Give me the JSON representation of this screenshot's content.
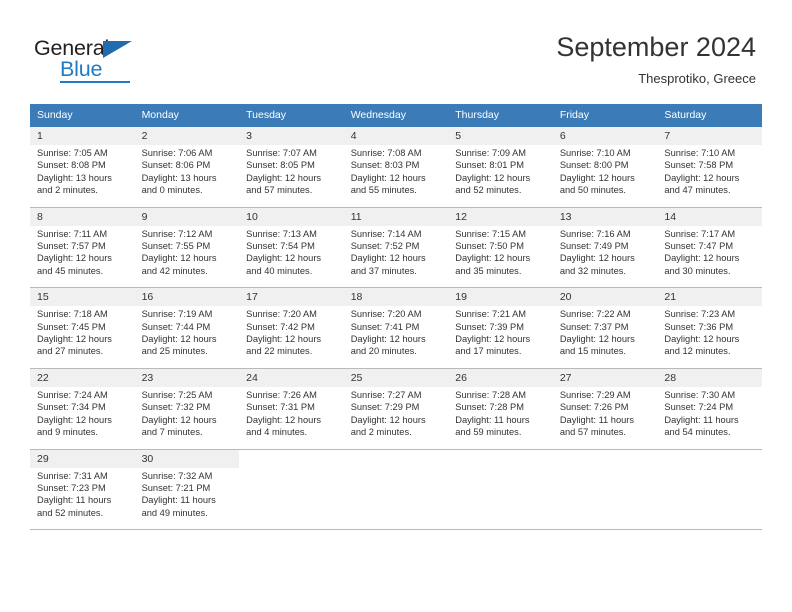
{
  "brand": {
    "name_top": "General",
    "name_bottom": "Blue",
    "accent_color": "#1f7bc4",
    "triangle_color": "#1f6cb0"
  },
  "header": {
    "title": "September 2024",
    "subtitle": "Thesprotiko, Greece"
  },
  "calendar": {
    "header_bg": "#3b7cb8",
    "daynum_bg": "#f0f0f0",
    "weekdays": [
      "Sunday",
      "Monday",
      "Tuesday",
      "Wednesday",
      "Thursday",
      "Friday",
      "Saturday"
    ],
    "weeks": [
      {
        "days": [
          {
            "num": "1",
            "sunrise": "Sunrise: 7:05 AM",
            "sunset": "Sunset: 8:08 PM",
            "daylight1": "Daylight: 13 hours",
            "daylight2": "and 2 minutes."
          },
          {
            "num": "2",
            "sunrise": "Sunrise: 7:06 AM",
            "sunset": "Sunset: 8:06 PM",
            "daylight1": "Daylight: 13 hours",
            "daylight2": "and 0 minutes."
          },
          {
            "num": "3",
            "sunrise": "Sunrise: 7:07 AM",
            "sunset": "Sunset: 8:05 PM",
            "daylight1": "Daylight: 12 hours",
            "daylight2": "and 57 minutes."
          },
          {
            "num": "4",
            "sunrise": "Sunrise: 7:08 AM",
            "sunset": "Sunset: 8:03 PM",
            "daylight1": "Daylight: 12 hours",
            "daylight2": "and 55 minutes."
          },
          {
            "num": "5",
            "sunrise": "Sunrise: 7:09 AM",
            "sunset": "Sunset: 8:01 PM",
            "daylight1": "Daylight: 12 hours",
            "daylight2": "and 52 minutes."
          },
          {
            "num": "6",
            "sunrise": "Sunrise: 7:10 AM",
            "sunset": "Sunset: 8:00 PM",
            "daylight1": "Daylight: 12 hours",
            "daylight2": "and 50 minutes."
          },
          {
            "num": "7",
            "sunrise": "Sunrise: 7:10 AM",
            "sunset": "Sunset: 7:58 PM",
            "daylight1": "Daylight: 12 hours",
            "daylight2": "and 47 minutes."
          }
        ]
      },
      {
        "days": [
          {
            "num": "8",
            "sunrise": "Sunrise: 7:11 AM",
            "sunset": "Sunset: 7:57 PM",
            "daylight1": "Daylight: 12 hours",
            "daylight2": "and 45 minutes."
          },
          {
            "num": "9",
            "sunrise": "Sunrise: 7:12 AM",
            "sunset": "Sunset: 7:55 PM",
            "daylight1": "Daylight: 12 hours",
            "daylight2": "and 42 minutes."
          },
          {
            "num": "10",
            "sunrise": "Sunrise: 7:13 AM",
            "sunset": "Sunset: 7:54 PM",
            "daylight1": "Daylight: 12 hours",
            "daylight2": "and 40 minutes."
          },
          {
            "num": "11",
            "sunrise": "Sunrise: 7:14 AM",
            "sunset": "Sunset: 7:52 PM",
            "daylight1": "Daylight: 12 hours",
            "daylight2": "and 37 minutes."
          },
          {
            "num": "12",
            "sunrise": "Sunrise: 7:15 AM",
            "sunset": "Sunset: 7:50 PM",
            "daylight1": "Daylight: 12 hours",
            "daylight2": "and 35 minutes."
          },
          {
            "num": "13",
            "sunrise": "Sunrise: 7:16 AM",
            "sunset": "Sunset: 7:49 PM",
            "daylight1": "Daylight: 12 hours",
            "daylight2": "and 32 minutes."
          },
          {
            "num": "14",
            "sunrise": "Sunrise: 7:17 AM",
            "sunset": "Sunset: 7:47 PM",
            "daylight1": "Daylight: 12 hours",
            "daylight2": "and 30 minutes."
          }
        ]
      },
      {
        "days": [
          {
            "num": "15",
            "sunrise": "Sunrise: 7:18 AM",
            "sunset": "Sunset: 7:45 PM",
            "daylight1": "Daylight: 12 hours",
            "daylight2": "and 27 minutes."
          },
          {
            "num": "16",
            "sunrise": "Sunrise: 7:19 AM",
            "sunset": "Sunset: 7:44 PM",
            "daylight1": "Daylight: 12 hours",
            "daylight2": "and 25 minutes."
          },
          {
            "num": "17",
            "sunrise": "Sunrise: 7:20 AM",
            "sunset": "Sunset: 7:42 PM",
            "daylight1": "Daylight: 12 hours",
            "daylight2": "and 22 minutes."
          },
          {
            "num": "18",
            "sunrise": "Sunrise: 7:20 AM",
            "sunset": "Sunset: 7:41 PM",
            "daylight1": "Daylight: 12 hours",
            "daylight2": "and 20 minutes."
          },
          {
            "num": "19",
            "sunrise": "Sunrise: 7:21 AM",
            "sunset": "Sunset: 7:39 PM",
            "daylight1": "Daylight: 12 hours",
            "daylight2": "and 17 minutes."
          },
          {
            "num": "20",
            "sunrise": "Sunrise: 7:22 AM",
            "sunset": "Sunset: 7:37 PM",
            "daylight1": "Daylight: 12 hours",
            "daylight2": "and 15 minutes."
          },
          {
            "num": "21",
            "sunrise": "Sunrise: 7:23 AM",
            "sunset": "Sunset: 7:36 PM",
            "daylight1": "Daylight: 12 hours",
            "daylight2": "and 12 minutes."
          }
        ]
      },
      {
        "days": [
          {
            "num": "22",
            "sunrise": "Sunrise: 7:24 AM",
            "sunset": "Sunset: 7:34 PM",
            "daylight1": "Daylight: 12 hours",
            "daylight2": "and 9 minutes."
          },
          {
            "num": "23",
            "sunrise": "Sunrise: 7:25 AM",
            "sunset": "Sunset: 7:32 PM",
            "daylight1": "Daylight: 12 hours",
            "daylight2": "and 7 minutes."
          },
          {
            "num": "24",
            "sunrise": "Sunrise: 7:26 AM",
            "sunset": "Sunset: 7:31 PM",
            "daylight1": "Daylight: 12 hours",
            "daylight2": "and 4 minutes."
          },
          {
            "num": "25",
            "sunrise": "Sunrise: 7:27 AM",
            "sunset": "Sunset: 7:29 PM",
            "daylight1": "Daylight: 12 hours",
            "daylight2": "and 2 minutes."
          },
          {
            "num": "26",
            "sunrise": "Sunrise: 7:28 AM",
            "sunset": "Sunset: 7:28 PM",
            "daylight1": "Daylight: 11 hours",
            "daylight2": "and 59 minutes."
          },
          {
            "num": "27",
            "sunrise": "Sunrise: 7:29 AM",
            "sunset": "Sunset: 7:26 PM",
            "daylight1": "Daylight: 11 hours",
            "daylight2": "and 57 minutes."
          },
          {
            "num": "28",
            "sunrise": "Sunrise: 7:30 AM",
            "sunset": "Sunset: 7:24 PM",
            "daylight1": "Daylight: 11 hours",
            "daylight2": "and 54 minutes."
          }
        ]
      },
      {
        "days": [
          {
            "num": "29",
            "sunrise": "Sunrise: 7:31 AM",
            "sunset": "Sunset: 7:23 PM",
            "daylight1": "Daylight: 11 hours",
            "daylight2": "and 52 minutes."
          },
          {
            "num": "30",
            "sunrise": "Sunrise: 7:32 AM",
            "sunset": "Sunset: 7:21 PM",
            "daylight1": "Daylight: 11 hours",
            "daylight2": "and 49 minutes."
          },
          {
            "num": "",
            "sunrise": "",
            "sunset": "",
            "daylight1": "",
            "daylight2": ""
          },
          {
            "num": "",
            "sunrise": "",
            "sunset": "",
            "daylight1": "",
            "daylight2": ""
          },
          {
            "num": "",
            "sunrise": "",
            "sunset": "",
            "daylight1": "",
            "daylight2": ""
          },
          {
            "num": "",
            "sunrise": "",
            "sunset": "",
            "daylight1": "",
            "daylight2": ""
          },
          {
            "num": "",
            "sunrise": "",
            "sunset": "",
            "daylight1": "",
            "daylight2": ""
          }
        ]
      }
    ]
  }
}
